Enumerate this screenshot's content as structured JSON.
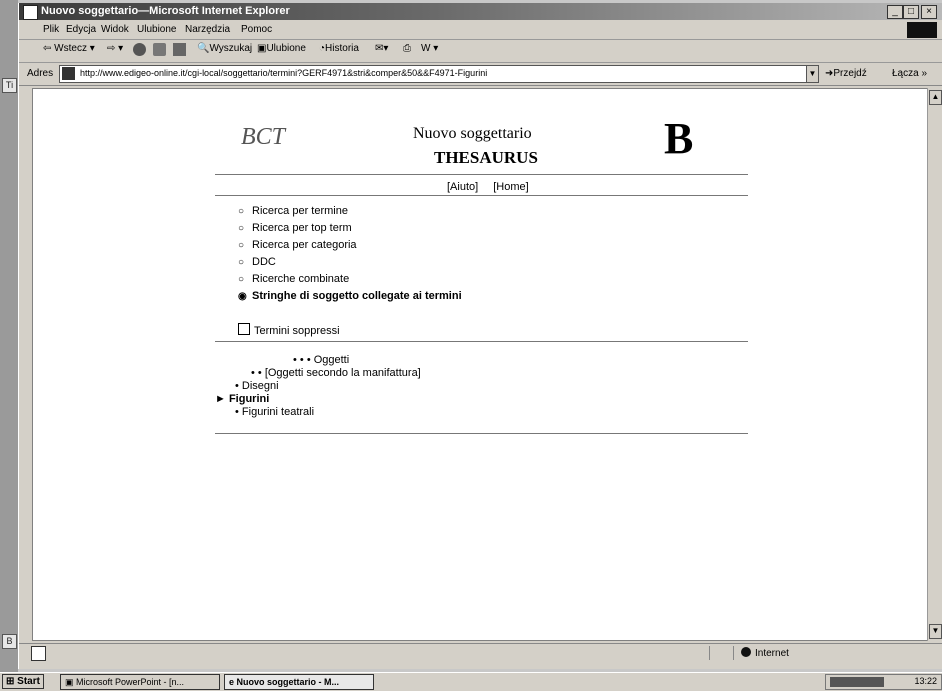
{
  "window": {
    "title": "Nuovo soggettario—Microsoft Internet Explorer"
  },
  "menubar": [
    "Plik",
    "Edycja",
    "Widok",
    "Ulubione",
    "Narzędzia",
    "Pomoc"
  ],
  "toolbar": {
    "back": "Wstecz",
    "search": "Wyszukaj",
    "favorites": "Ulubione",
    "history": "Historia"
  },
  "address": {
    "label": "Adres",
    "url": "http://www.edigeo-online.it/cgi-local/soggettario/termini?GERF4971&stri&comper&50&&F4971-Figurini",
    "go": "Przejdź",
    "links": "Łącza"
  },
  "page": {
    "logo_left": "BCT",
    "title1": "Nuovo soggettario",
    "title2": "THESAURUS",
    "logo_right": "B",
    "nav": [
      "[Aiuto]",
      "[Home]"
    ],
    "radios": [
      {
        "label": "Ricerca per termine",
        "selected": false
      },
      {
        "label": "Ricerca per top term",
        "selected": false
      },
      {
        "label": "Ricerca per categoria",
        "selected": false
      },
      {
        "label": "DDC",
        "selected": false
      },
      {
        "label": "Ricerche combinate",
        "selected": false
      },
      {
        "label": "Stringhe di soggetto collegate ai termini",
        "selected": true
      }
    ],
    "checkbox": "Termini soppressi",
    "tree": [
      {
        "text": "• • • Oggetti",
        "level": 3
      },
      {
        "text": "• • [Oggetti secondo la manifattura]",
        "level": 2
      },
      {
        "text": "• Disegni",
        "level": 1
      },
      {
        "text": "► Figurini",
        "level": 0,
        "current": true
      },
      {
        "text": "• Figurini teatrali",
        "level": 1
      }
    ]
  },
  "status": {
    "zone": "Internet"
  },
  "taskbar": {
    "start": "Start",
    "tasks": [
      "Microsoft PowerPoint - [n...",
      "Nuovo soggettario - M..."
    ],
    "clock": "13:22"
  },
  "desktop_left": [
    "Ti",
    "B"
  ]
}
